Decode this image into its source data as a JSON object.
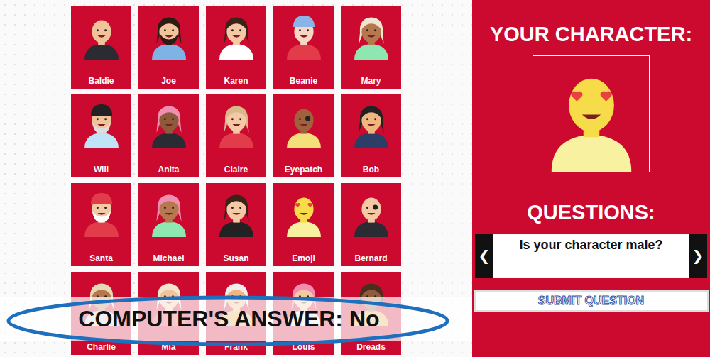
{
  "board": {
    "characters": [
      {
        "name": "Baldie",
        "selected": false
      },
      {
        "name": "Joe",
        "selected": false
      },
      {
        "name": "Karen",
        "selected": false
      },
      {
        "name": "Beanie",
        "selected": false
      },
      {
        "name": "Mary",
        "selected": false
      },
      {
        "name": "Will",
        "selected": false
      },
      {
        "name": "Anita",
        "selected": false
      },
      {
        "name": "Claire",
        "selected": false
      },
      {
        "name": "Eyepatch",
        "selected": false
      },
      {
        "name": "Bob",
        "selected": false
      },
      {
        "name": "Santa",
        "selected": false
      },
      {
        "name": "Michael",
        "selected": false
      },
      {
        "name": "Susan",
        "selected": false
      },
      {
        "name": "Emoji",
        "selected": true
      },
      {
        "name": "Bernard",
        "selected": false
      },
      {
        "name": "Charlie",
        "selected": false
      },
      {
        "name": "Mia",
        "selected": false
      },
      {
        "name": "Frank",
        "selected": false
      },
      {
        "name": "Louis",
        "selected": false
      },
      {
        "name": "Dreads",
        "selected": false
      }
    ],
    "answer": {
      "label": "COMPUTER'S ANSWER:",
      "value": "No"
    }
  },
  "panel": {
    "your_character_title": "YOUR CHARACTER:",
    "questions_title": "QUESTIONS:",
    "question": "Is your character male?",
    "prev": "❮",
    "next": "❯",
    "submit": "SUBMIT QUESTION"
  }
}
